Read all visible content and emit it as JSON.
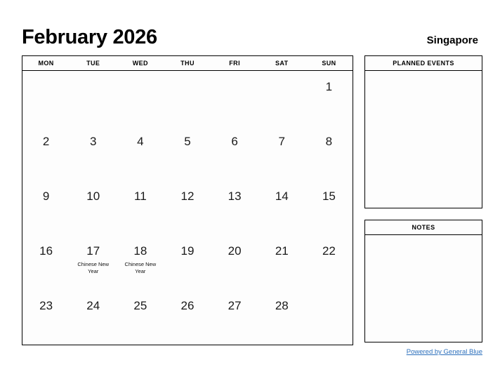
{
  "header": {
    "month_title": "February 2026",
    "location": "Singapore"
  },
  "calendar": {
    "weekdays": [
      "MON",
      "TUE",
      "WED",
      "THU",
      "FRI",
      "SAT",
      "SUN"
    ],
    "weeks": [
      [
        {
          "day": ""
        },
        {
          "day": ""
        },
        {
          "day": ""
        },
        {
          "day": ""
        },
        {
          "day": ""
        },
        {
          "day": ""
        },
        {
          "day": "1"
        }
      ],
      [
        {
          "day": "2"
        },
        {
          "day": "3"
        },
        {
          "day": "4"
        },
        {
          "day": "5"
        },
        {
          "day": "6"
        },
        {
          "day": "7"
        },
        {
          "day": "8"
        }
      ],
      [
        {
          "day": "9"
        },
        {
          "day": "10"
        },
        {
          "day": "11"
        },
        {
          "day": "12"
        },
        {
          "day": "13"
        },
        {
          "day": "14"
        },
        {
          "day": "15"
        }
      ],
      [
        {
          "day": "16"
        },
        {
          "day": "17",
          "event": "Chinese New Year"
        },
        {
          "day": "18",
          "event": "Chinese New Year"
        },
        {
          "day": "19"
        },
        {
          "day": "20"
        },
        {
          "day": "21"
        },
        {
          "day": "22"
        }
      ],
      [
        {
          "day": "23"
        },
        {
          "day": "24"
        },
        {
          "day": "25"
        },
        {
          "day": "26"
        },
        {
          "day": "27"
        },
        {
          "day": "28"
        },
        {
          "day": ""
        }
      ]
    ]
  },
  "panels": {
    "planned_events": {
      "title": "PLANNED EVENTS",
      "content": ""
    },
    "notes": {
      "title": "NOTES",
      "content": ""
    }
  },
  "footer": {
    "link_text": "Powered by General Blue"
  },
  "colors": {
    "link": "#2a6ebb",
    "border": "#000000",
    "text": "#111111",
    "page_background": "#ffffff",
    "cell_background": "#fdfdfd"
  }
}
